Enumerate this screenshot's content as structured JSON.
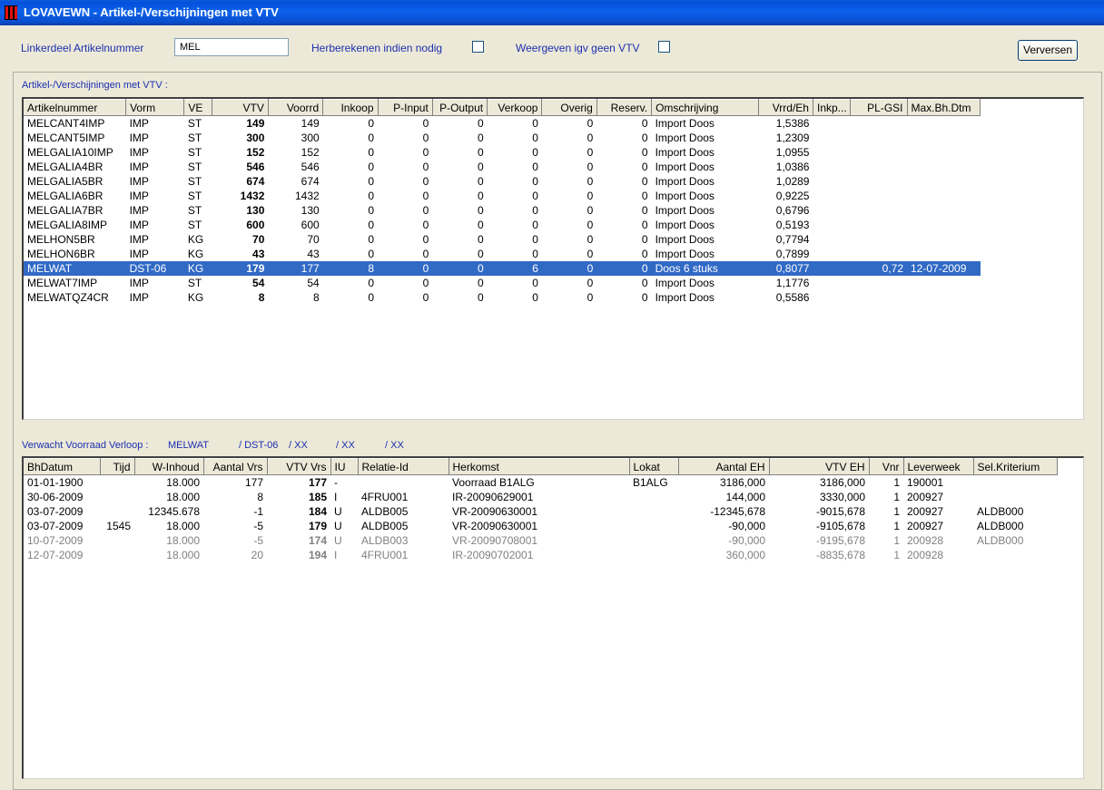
{
  "window": {
    "title": "LOVAVEWN - Artikel-/Verschijningen met VTV"
  },
  "filters": {
    "linkerdeel_label": "Linkerdeel Artikelnummer",
    "linkerdeel_value": "MEL",
    "herberekenen_label": "Herberekenen indien nodig",
    "herberekenen_checked": false,
    "weergeven_label": "Weergeven igv geen VTV",
    "weergeven_checked": false,
    "refresh_label": "Verversen"
  },
  "articles": {
    "section_title": "Artikel-/Verschijningen met VTV :",
    "columns": [
      "Artikelnummer",
      "Vorm",
      "VE",
      "VTV",
      "Voorrd",
      "Inkoop",
      "P-Input",
      "P-Output",
      "Verkoop",
      "Overig",
      "Reserv.",
      "Omschrijving",
      "Vrrd/Eh",
      "Inkp...",
      "PL-GSI",
      "Max.Bh.Dtm"
    ],
    "rows": [
      [
        "MELCANT4IMP",
        "IMP",
        "ST",
        "149",
        "149",
        "0",
        "0",
        "0",
        "0",
        "0",
        "0",
        "Import Doos",
        "1,5386",
        "",
        "",
        ""
      ],
      [
        "MELCANT5IMP",
        "IMP",
        "ST",
        "300",
        "300",
        "0",
        "0",
        "0",
        "0",
        "0",
        "0",
        "Import Doos",
        "1,2309",
        "",
        "",
        ""
      ],
      [
        "MELGALIA10IMP",
        "IMP",
        "ST",
        "152",
        "152",
        "0",
        "0",
        "0",
        "0",
        "0",
        "0",
        "Import Doos",
        "1,0955",
        "",
        "",
        ""
      ],
      [
        "MELGALIA4BR",
        "IMP",
        "ST",
        "546",
        "546",
        "0",
        "0",
        "0",
        "0",
        "0",
        "0",
        "Import Doos",
        "1,0386",
        "",
        "",
        ""
      ],
      [
        "MELGALIA5BR",
        "IMP",
        "ST",
        "674",
        "674",
        "0",
        "0",
        "0",
        "0",
        "0",
        "0",
        "Import Doos",
        "1,0289",
        "",
        "",
        ""
      ],
      [
        "MELGALIA6BR",
        "IMP",
        "ST",
        "1432",
        "1432",
        "0",
        "0",
        "0",
        "0",
        "0",
        "0",
        "Import Doos",
        "0,9225",
        "",
        "",
        ""
      ],
      [
        "MELGALIA7BR",
        "IMP",
        "ST",
        "130",
        "130",
        "0",
        "0",
        "0",
        "0",
        "0",
        "0",
        "Import Doos",
        "0,6796",
        "",
        "",
        ""
      ],
      [
        "MELGALIA8IMP",
        "IMP",
        "ST",
        "600",
        "600",
        "0",
        "0",
        "0",
        "0",
        "0",
        "0",
        "Import Doos",
        "0,5193",
        "",
        "",
        ""
      ],
      [
        "MELHON5BR",
        "IMP",
        "KG",
        "70",
        "70",
        "0",
        "0",
        "0",
        "0",
        "0",
        "0",
        "Import Doos",
        "0,7794",
        "",
        "",
        ""
      ],
      [
        "MELHON6BR",
        "IMP",
        "KG",
        "43",
        "43",
        "0",
        "0",
        "0",
        "0",
        "0",
        "0",
        "Import Doos",
        "0,7899",
        "",
        "",
        ""
      ],
      [
        "MELWAT",
        "DST-06",
        "KG",
        "179",
        "177",
        "8",
        "0",
        "0",
        "6",
        "0",
        "0",
        "Doos 6 stuks",
        "0,8077",
        "",
        "0,72",
        "12-07-2009"
      ],
      [
        "MELWAT7IMP",
        "IMP",
        "ST",
        "54",
        "54",
        "0",
        "0",
        "0",
        "0",
        "0",
        "0",
        "Import Doos",
        "1,1776",
        "",
        "",
        ""
      ],
      [
        "MELWATQZ4CR",
        "IMP",
        "KG",
        "8",
        "8",
        "0",
        "0",
        "0",
        "0",
        "0",
        "0",
        "Import Doos",
        "0,5586",
        "",
        "",
        ""
      ]
    ],
    "selected_row": 10
  },
  "verloop": {
    "label": "Verwacht Voorraad Verloop :",
    "article": "MELWAT",
    "vorm": "/ DST-06",
    "xx1": "/ XX",
    "xx2": "/ XX",
    "xx3": "/ XX",
    "columns": [
      "BhDatum",
      "Tijd",
      "W-Inhoud",
      "Aantal Vrs",
      "VTV Vrs",
      "IU",
      "Relatie-Id",
      "Herkomst",
      "Lokat",
      "Aantal EH",
      "VTV EH",
      "Vnr",
      "Leverweek",
      "Sel.Kriterium"
    ],
    "rows": [
      [
        "01-01-1900",
        "",
        "18.000",
        "177",
        "177",
        "-",
        "",
        "Voorraad B1ALG",
        "B1ALG",
        "3186,000",
        "3186,000",
        "1",
        "190001",
        ""
      ],
      [
        "30-06-2009",
        "",
        "18.000",
        "8",
        "185",
        "I",
        "4FRU001",
        "IR-20090629001",
        "",
        "144,000",
        "3330,000",
        "1",
        "200927",
        ""
      ],
      [
        "03-07-2009",
        "",
        "12345.678",
        "-1",
        "184",
        "U",
        "ALDB005",
        "VR-20090630001",
        "",
        "-12345,678",
        "-9015,678",
        "1",
        "200927",
        "ALDB000"
      ],
      [
        "03-07-2009",
        "1545",
        "18.000",
        "-5",
        "179",
        "U",
        "ALDB005",
        "VR-20090630001",
        "",
        "-90,000",
        "-9105,678",
        "1",
        "200927",
        "ALDB000"
      ],
      [
        "10-07-2009",
        "",
        "18.000",
        "-5",
        "174",
        "U",
        "ALDB003",
        "VR-20090708001",
        "",
        "-90,000",
        "-9195,678",
        "1",
        "200928",
        "ALDB000"
      ],
      [
        "12-07-2009",
        "",
        "18.000",
        "20",
        "194",
        "I",
        "4FRU001",
        "IR-20090702001",
        "",
        "360,000",
        "-8835,678",
        "1",
        "200928",
        ""
      ]
    ],
    "future_rows_start": 4
  }
}
